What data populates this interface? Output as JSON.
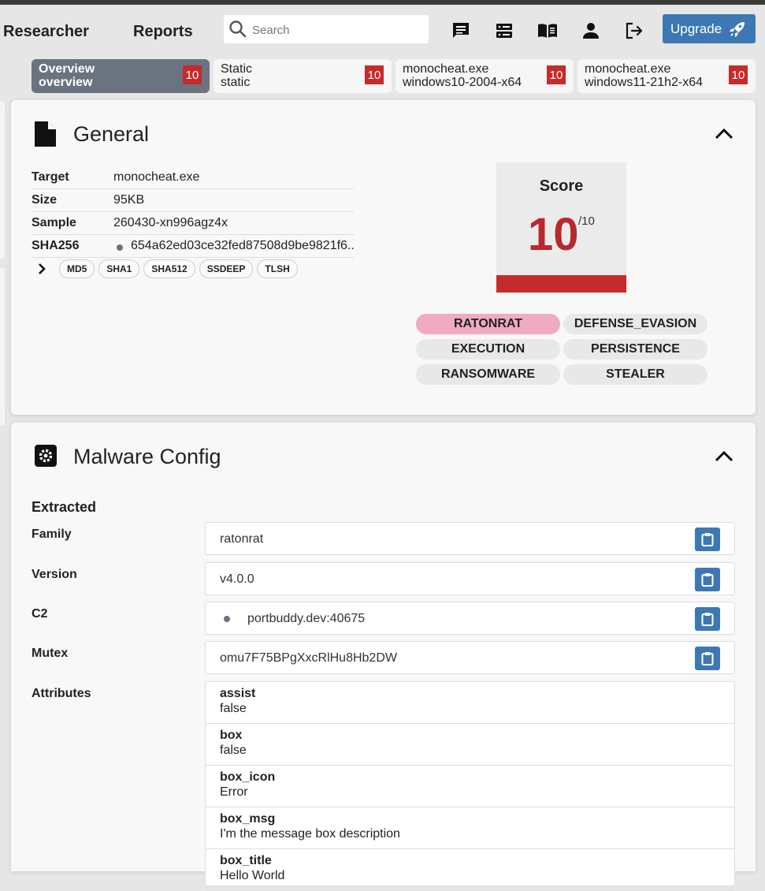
{
  "nav": {
    "researcher": "Researcher",
    "reports": "Reports",
    "search_placeholder": "Search",
    "icons": [
      "chat-icon",
      "server-icon",
      "book-icon",
      "user-icon",
      "logout-icon"
    ],
    "upgrade": "Upgrade"
  },
  "tabs": [
    {
      "line1": "Overview",
      "line2": "overview",
      "score": "10",
      "active": true
    },
    {
      "line1": "Static",
      "line2": "static",
      "score": "10",
      "active": false
    },
    {
      "line1": "monocheat.exe",
      "line2": "windows10-2004-x64",
      "score": "10",
      "active": false
    },
    {
      "line1": "monocheat.exe",
      "line2": "windows11-21h2-x64",
      "score": "10",
      "active": false
    }
  ],
  "general": {
    "title": "General",
    "rows": [
      {
        "key": "Target",
        "value": "monocheat.exe"
      },
      {
        "key": "Size",
        "value": "95KB"
      },
      {
        "key": "Sample",
        "value": "260430-xn996agz4x"
      },
      {
        "key": "SHA256",
        "value": "654a62ed03ce32fed87508d9be9821f6..."
      }
    ],
    "hashes": [
      "MD5",
      "SHA1",
      "SHA512",
      "SSDEEP",
      "TLSH"
    ],
    "score_label": "Score",
    "score": "10",
    "score_max": "/10",
    "tags": [
      "RATONRAT",
      "DEFENSE_EVASION",
      "EXECUTION",
      "PERSISTENCE",
      "RANSOMWARE",
      "STEALER"
    ]
  },
  "malware_config": {
    "title": "Malware Config",
    "extracted": "Extracted",
    "family_label": "Family",
    "family": "ratonrat",
    "version_label": "Version",
    "version": "v4.0.0",
    "c2_label": "C2",
    "c2": "portbuddy.dev:40675",
    "mutex_label": "Mutex",
    "mutex": "omu7F75BPgXxcRlHu8Hb2DW",
    "attributes_label": "Attributes",
    "attributes": [
      {
        "key": "assist",
        "value": "false"
      },
      {
        "key": "box",
        "value": "false"
      },
      {
        "key": "box_icon",
        "value": "Error"
      },
      {
        "key": "box_msg",
        "value": "I'm the message box description"
      },
      {
        "key": "box_title",
        "value": "Hello World"
      }
    ]
  },
  "colors": {
    "accent": "#3d78b4",
    "danger": "#c62b2b",
    "family_tag": "#f0aac3",
    "active_tab": "#6b7280"
  }
}
